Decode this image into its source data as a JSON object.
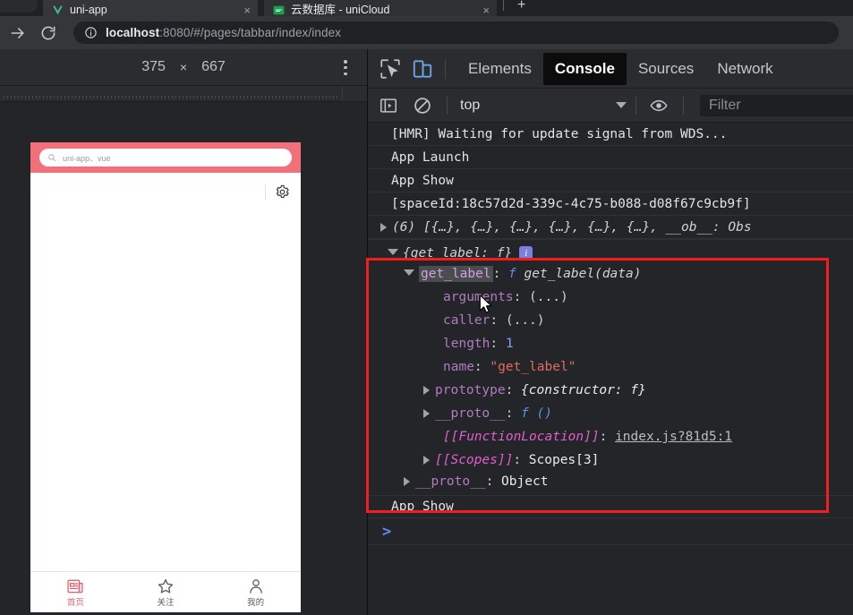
{
  "browser": {
    "tabs": [
      {
        "title": "uni-app",
        "favicon": "vue-logo-icon",
        "active": true,
        "close_label": "×"
      },
      {
        "title": "云数据库 - uniCloud",
        "favicon": "unicloud-icon",
        "active": false,
        "close_label": "×"
      }
    ],
    "new_tab_label": "+",
    "omnibar": {
      "back_icon": "arrow-right-icon",
      "reload_icon": "reload-icon",
      "info_icon": "info-circle-icon",
      "url_host": "localhost",
      "url_rest": ":8080/#/pages/tabbar/index/index"
    }
  },
  "device_toolbar": {
    "width": "375",
    "x_symbol": "×",
    "height": "667",
    "menu_icon": "kebab-menu-icon"
  },
  "phone": {
    "search": {
      "icon": "search-icon",
      "value": "uni-app、vue"
    },
    "settings_icon": "gear-icon",
    "tabbar": [
      {
        "label": "首页",
        "icon": "news-icon",
        "active": true
      },
      {
        "label": "关注",
        "icon": "star-icon",
        "active": false
      },
      {
        "label": "我的",
        "icon": "person-icon",
        "active": false
      }
    ]
  },
  "devtools": {
    "inspect_icon": "inspect-cursor-icon",
    "device_toggle_icon": "device-toolbar-icon",
    "panels": [
      {
        "label": "Elements",
        "active": false
      },
      {
        "label": "Console",
        "active": true
      },
      {
        "label": "Sources",
        "active": false
      },
      {
        "label": "Network",
        "active": false
      }
    ],
    "filterbar": {
      "sidebar_icon": "console-sidebar-icon",
      "clear_icon": "clear-console-icon",
      "context": "top",
      "context_caret": "chevron-down-icon",
      "eye_icon": "live-expression-eye-icon",
      "filter_placeholder": "Filter"
    },
    "console": {
      "entries": [
        {
          "type": "text",
          "text": "[HMR] Waiting for update signal from WDS..."
        },
        {
          "type": "text",
          "text": "App Launch"
        },
        {
          "type": "text",
          "text": "App Show"
        },
        {
          "type": "text",
          "text": "[spaceId:18c57d2d-339c-4c75-b088-d08f67c9cb9f]"
        },
        {
          "type": "array",
          "text": "(6) [{…}, {…}, {…}, {…}, {…}, {…}, __ob__: Obs"
        }
      ],
      "expanded_object": {
        "summary": "{get_label: f}",
        "info_badge": "i",
        "root_prop": "get_label",
        "root_fn_marker": "f",
        "root_fn_signature": "get_label(data)",
        "props": [
          {
            "name": "arguments",
            "value": "(...)",
            "expandable": false
          },
          {
            "name": "caller",
            "value": "(...)",
            "expandable": false
          },
          {
            "name": "length",
            "value": "1",
            "value_kind": "number",
            "expandable": false
          },
          {
            "name": "name",
            "value": "\"get_label\"",
            "value_kind": "string",
            "expandable": false
          },
          {
            "name": "prototype",
            "value": "{constructor: f}",
            "expandable": true
          },
          {
            "name": "__proto__",
            "value": "f ()",
            "value_kind": "fn",
            "expandable": true
          },
          {
            "name": "[[FunctionLocation]]",
            "value": "index.js?81d5:1",
            "value_kind": "link",
            "expandable": false
          },
          {
            "name": "[[Scopes]]",
            "value": "Scopes[3]",
            "expandable": true
          }
        ],
        "tail_prop": {
          "name": "__proto__",
          "value": "Object",
          "expandable": true
        }
      },
      "trailing_entries": [
        {
          "type": "text",
          "text": "App Show"
        }
      ],
      "prompt": ">"
    }
  },
  "annotation": {
    "highlight_color": "#f41d1d"
  }
}
